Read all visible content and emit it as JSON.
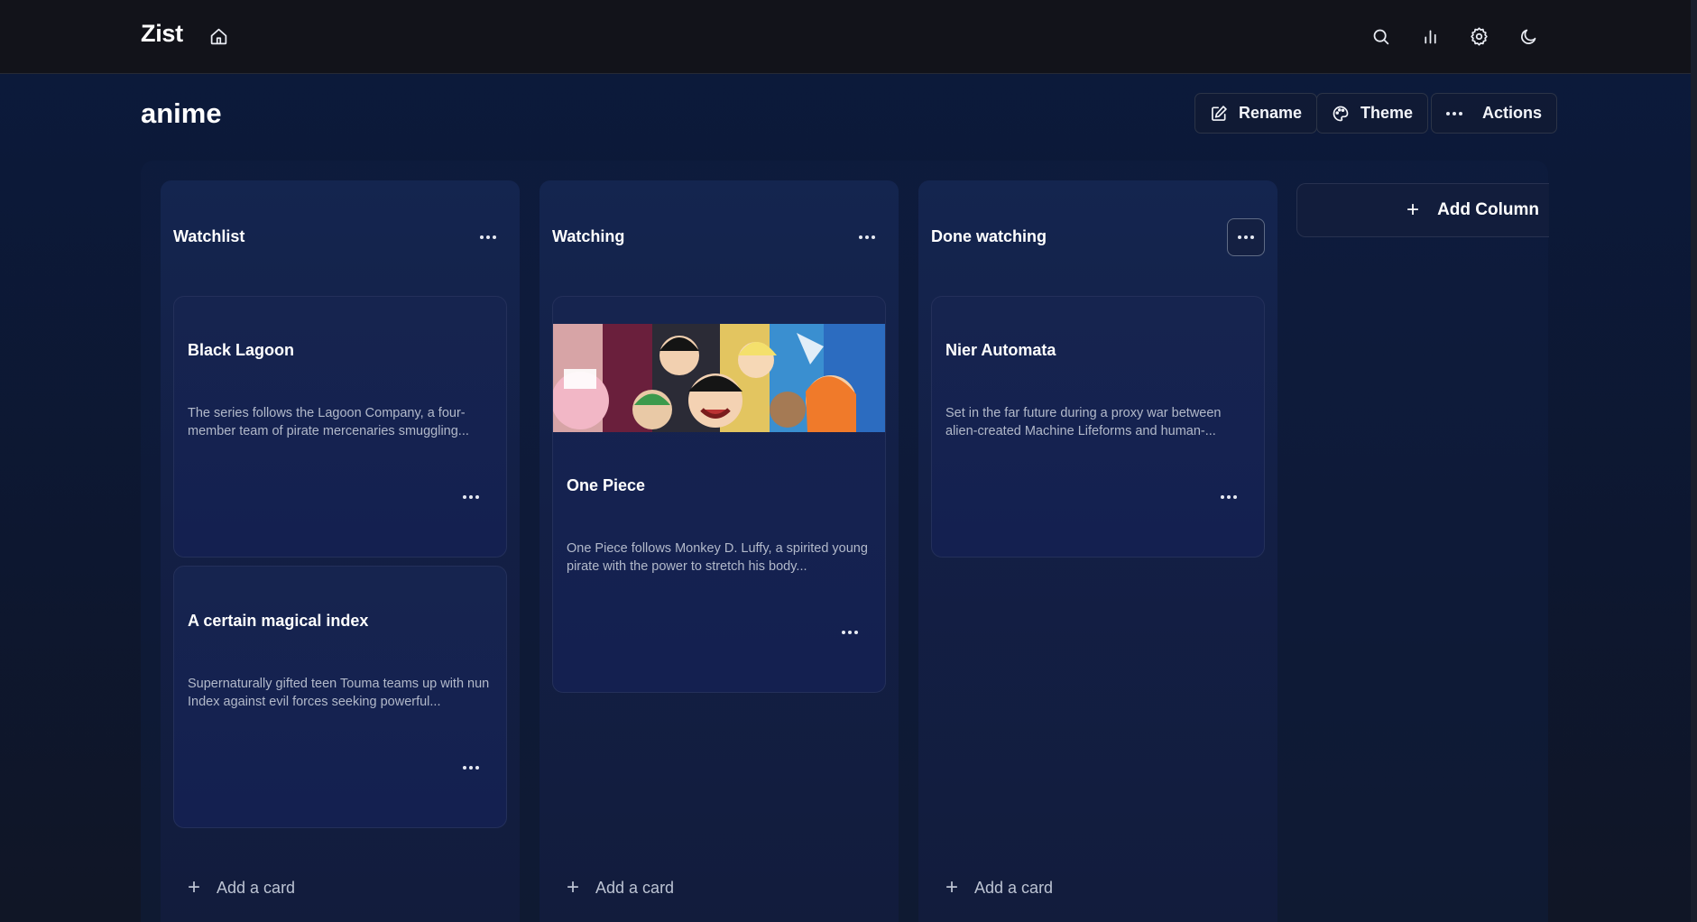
{
  "app": {
    "brand": "Zist"
  },
  "nav": {
    "icons": [
      "home-icon",
      "search-icon",
      "stats-icon",
      "gear-icon",
      "moon-icon"
    ]
  },
  "board": {
    "title": "anime",
    "actions": {
      "rename_label": "Rename",
      "theme_label": "Theme",
      "actions_label": "Actions"
    },
    "add_column_label": "Add Column",
    "columns": [
      {
        "title": "Watchlist",
        "add_card_label": "Add a card",
        "cards": [
          {
            "title": "Black Lagoon",
            "description": "The series follows the Lagoon Company, a four-member team of pirate mercenaries smuggling..."
          },
          {
            "title": "A certain magical index",
            "description": "Supernaturally gifted teen Touma teams up with nun Index against evil forces seeking powerful..."
          }
        ]
      },
      {
        "title": "Watching",
        "add_card_label": "Add a card",
        "cards": [
          {
            "title": "One Piece",
            "description": "One Piece follows Monkey D. Luffy, a spirited young pirate with the power to stretch his body...",
            "has_image": true
          }
        ]
      },
      {
        "title": "Done watching",
        "add_card_label": "Add a card",
        "cards": [
          {
            "title": "Nier Automata",
            "description": "Set in the far future during a proxy war between alien-created Machine Lifeforms and human-..."
          }
        ]
      }
    ]
  },
  "colors": {
    "topbar": "#12131a",
    "background": "#0c1a3c",
    "card": "#16244f",
    "text": "#ffffff",
    "muted_text": "#b2b9ca"
  }
}
